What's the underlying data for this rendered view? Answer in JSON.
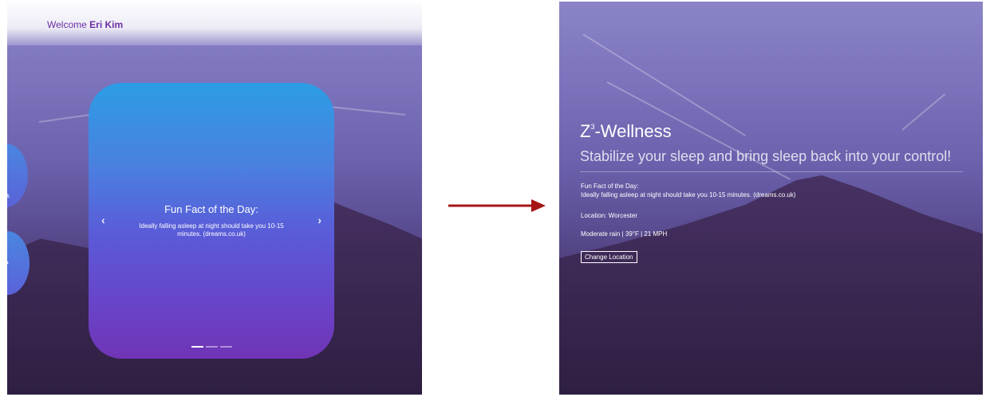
{
  "left_screen": {
    "header": {
      "welcome_prefix": "Welcome",
      "user_name": "Eri Kim"
    },
    "fun_fact_card": {
      "title": "Fun Fact of the Day:",
      "text": "Ideally falling asleep at night should take you 10-15 minutes. (dreams.co.uk)",
      "prev_icon": "chevron-left-icon",
      "next_icon": "chevron-right-icon",
      "slide_count": 3,
      "active_slide": 1
    }
  },
  "arrow": {
    "icon": "arrow-right-icon",
    "color": "#a51515"
  },
  "right_screen": {
    "title_prefix": "Z",
    "title_superscript": "3",
    "title_suffix": "-Wellness",
    "subtitle": "Stabilize your sleep and bring sleep back into your control!",
    "fun_fact_label": "Fun Fact of the Day:",
    "fun_fact_text": "Ideally falling asleep at night should take you 10-15 minutes. (dreams.co.uk)",
    "location_text": "Location: Worcester",
    "weather_text": "Moderate rain | 39°F | 21 MPH",
    "change_location_label": "Change Location"
  },
  "colors": {
    "brand_purple": "#6b2fa3",
    "card_top": "#2c9de5",
    "card_bottom": "#7034b6"
  }
}
